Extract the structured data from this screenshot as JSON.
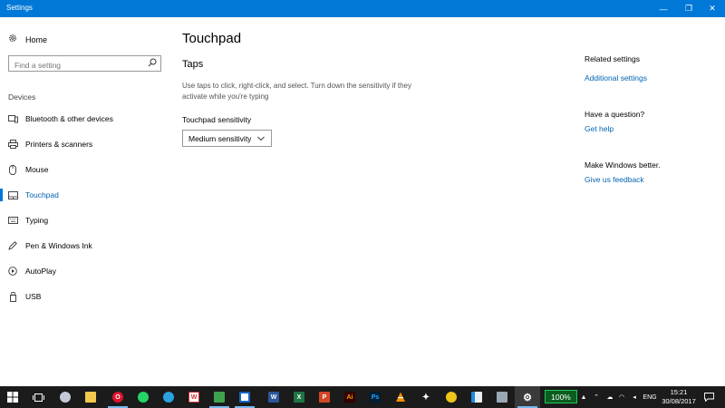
{
  "window": {
    "title": "Settings",
    "controls": {
      "minimize": "—",
      "maximize": "❐",
      "close": "✕"
    }
  },
  "sidebar": {
    "home_label": "Home",
    "search_placeholder": "Find a setting",
    "group_label": "Devices",
    "items": [
      {
        "label": "Bluetooth & other devices",
        "icon": "bluetooth-devices-icon"
      },
      {
        "label": "Printers & scanners",
        "icon": "printer-icon"
      },
      {
        "label": "Mouse",
        "icon": "mouse-icon"
      },
      {
        "label": "Touchpad",
        "icon": "touchpad-icon",
        "active": true
      },
      {
        "label": "Typing",
        "icon": "keyboard-icon"
      },
      {
        "label": "Pen & Windows Ink",
        "icon": "pen-icon"
      },
      {
        "label": "AutoPlay",
        "icon": "autoplay-icon"
      },
      {
        "label": "USB",
        "icon": "usb-icon"
      }
    ]
  },
  "main": {
    "title": "Touchpad",
    "section_title": "Taps",
    "description": "Use taps to click, right-click, and select. Turn down the sensitivity if they activate while you're typing",
    "sensitivity_label": "Touchpad sensitivity",
    "sensitivity_value": "Medium sensitivity"
  },
  "right_panel": {
    "related_heading": "Related settings",
    "additional_link": "Additional settings",
    "question_heading": "Have a question?",
    "help_link": "Get help",
    "feedback_heading": "Make Windows better.",
    "feedback_link": "Give us feedback"
  },
  "taskbar": {
    "battery": "100%",
    "language": "ENG",
    "time": "15:21",
    "date": "30/08/2017",
    "accent": "#0078d7"
  }
}
